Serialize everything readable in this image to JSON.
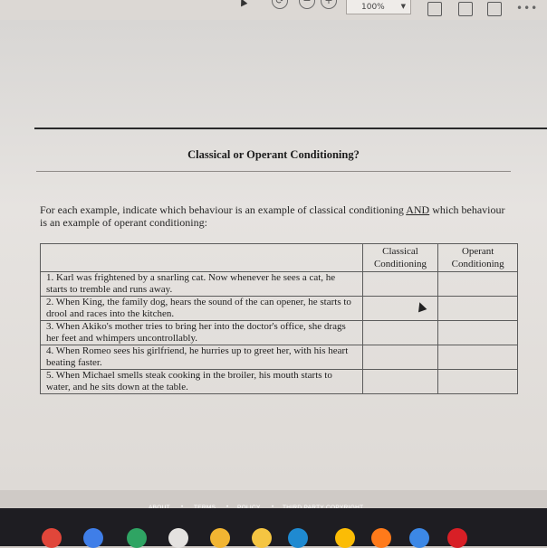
{
  "toolbar": {
    "zoom_level": "100%",
    "zoom_out_icon": "−",
    "zoom_in_icon": "+"
  },
  "document": {
    "title": "Classical or Operant Conditioning?",
    "intro_before": "For each example, indicate which behaviour is an example of classical conditioning ",
    "intro_emph": "AND",
    "intro_after": " which behaviour is an example of operant conditioning:",
    "table": {
      "headers": [
        "Classical Conditioning",
        "Operant Conditioning"
      ],
      "rows": [
        "1. Karl was frightened by a snarling cat. Now whenever he sees a cat, he starts to tremble and runs away.",
        "2. When King, the family dog, hears the sound of the can opener, he starts to drool and races into the kitchen.",
        "3. When Akiko's mother tries to bring her into the doctor's office, she drags her feet and whimpers uncontrollably.",
        "4. When Romeo sees his girlfriend, he hurries up to greet her, with his heart beating faster.",
        "5. When Michael smells steak cooking in the broiler, his mouth starts to water, and he sits down at the table."
      ]
    }
  },
  "footer": {
    "links": [
      "ABOUT",
      "TERMS",
      "POLICY",
      "THIRD PARTY COPYRIGHT"
    ]
  },
  "taskbar": {
    "apps": [
      {
        "name": "chrome-icon",
        "color": "#e0463a"
      },
      {
        "name": "docs-icon",
        "color": "#3f7ee8"
      },
      {
        "name": "play-store-icon",
        "color": "#2fa463"
      },
      {
        "name": "gmail-icon",
        "color": "#e4e2e0"
      },
      {
        "name": "classroom-icon",
        "color": "#f2b532"
      },
      {
        "name": "chat-icon",
        "color": "#f5c542"
      },
      {
        "name": "prime-video-icon",
        "color": "#1f8ad1"
      },
      {
        "name": "drive-icon",
        "color": "#fbbc05"
      },
      {
        "name": "firefox-icon",
        "color": "#ff7a1a"
      },
      {
        "name": "files-icon",
        "color": "#3c88e6"
      },
      {
        "name": "netflix-icon",
        "color": "#d81f26"
      }
    ]
  }
}
